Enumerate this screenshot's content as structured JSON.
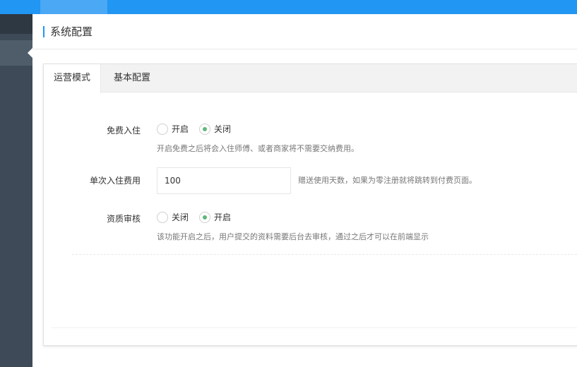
{
  "page": {
    "title": "系统配置"
  },
  "tabs": [
    {
      "label": "运营模式",
      "active": true
    },
    {
      "label": "基本配置",
      "active": false
    }
  ],
  "form": {
    "free_entry": {
      "label": "免费入住",
      "options": [
        {
          "label": "开启",
          "checked": false
        },
        {
          "label": "关闭",
          "checked": true
        }
      ],
      "hint": "开启免费之后将会入住师傅、或者商家将不需要交纳费用。"
    },
    "entry_fee": {
      "label": "单次入住费用",
      "value": "100",
      "hint": "赠送使用天数，如果为零注册就将跳转到付费页面。"
    },
    "qualification": {
      "label": "资质审核",
      "options": [
        {
          "label": "关闭",
          "checked": false
        },
        {
          "label": "开启",
          "checked": true
        }
      ],
      "hint": "该功能开启之后，用户提交的资料需要后台去审核，通过之后才可以在前端显示"
    }
  },
  "colors": {
    "primary": "#2196f3",
    "sidebar": "#3e4a57",
    "radio_checked": "#5fb878"
  }
}
